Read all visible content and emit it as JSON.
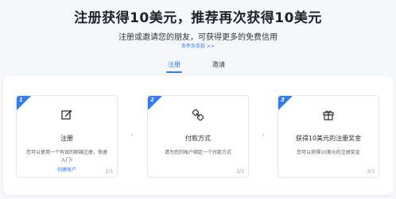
{
  "hero": {
    "title": "注册获得10美元，推荐再次获得10美元",
    "subtitle": "注册或邀请您的朋友，可获得更多的免费信用",
    "terms_link": "条件及条款 >>"
  },
  "tabs": [
    {
      "label": "注册",
      "active": true
    },
    {
      "label": "邀请",
      "active": false
    }
  ],
  "cards": [
    {
      "number": "1",
      "icon": "edit-icon",
      "title": "注册",
      "description": "您可以使用一个有效的邮箱注册，快速入门!",
      "link": "创建账户",
      "step": "1/3"
    },
    {
      "number": "2",
      "icon": "link-icon",
      "title": "付款方式",
      "description": "请为您的账户绑定一个付款方式",
      "step": "2/3"
    },
    {
      "number": "3",
      "icon": "gift-icon",
      "title": "获得10美元的注册奖金",
      "description": "您可以获得10美元的注册奖金",
      "step": "3/3"
    }
  ],
  "colors": {
    "accent": "#2f7cf6",
    "background": "#f5f7fb"
  }
}
